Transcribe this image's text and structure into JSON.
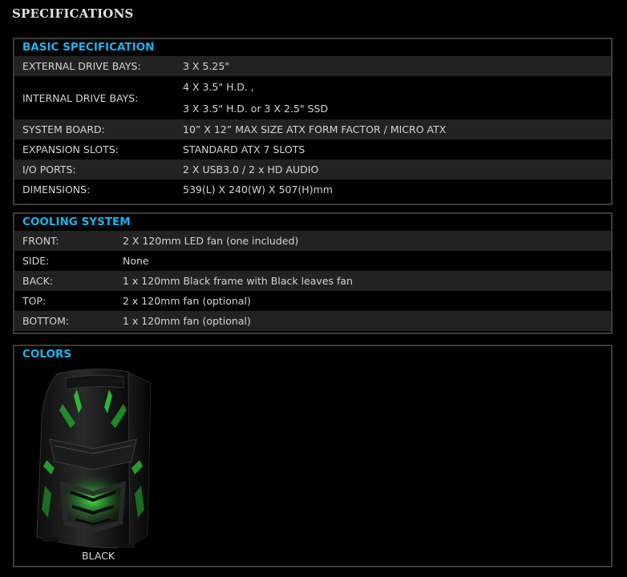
{
  "page": {
    "title": "SPECIFICATIONS"
  },
  "basic": {
    "heading": "BASIC SPECIFICATION",
    "rows": [
      {
        "key": "EXTERNAL DRIVE BAYS:",
        "value": "3 X 5.25\""
      },
      {
        "key": "INTERNAL DRIVE BAYS:",
        "values": [
          "4 X 3.5\" H.D. ,",
          "3 X 3.5\" H.D. or 3 X 2.5\" SSD"
        ]
      },
      {
        "key": "SYSTEM BOARD:",
        "value": "10” X 12” MAX SIZE ATX FORM FACTOR / MICRO ATX"
      },
      {
        "key": "EXPANSION SLOTS:",
        "value": "STANDARD ATX 7 SLOTS"
      },
      {
        "key": "I/O PORTS:",
        "value": "2 X USB3.0 / 2 x HD AUDIO"
      },
      {
        "key": "DIMENSIONS:",
        "value": "539(L) X 240(W) X 507(H)mm"
      }
    ]
  },
  "cooling": {
    "heading": "COOLING SYSTEM",
    "rows": [
      {
        "key": "FRONT:",
        "value": "2 X 120mm LED fan (one included)"
      },
      {
        "key": "SIDE:",
        "value": "None"
      },
      {
        "key": "BACK:",
        "value": "1 x 120mm Black frame with Black leaves fan"
      },
      {
        "key": "TOP:",
        "value": "2 x 120mm fan (optional)"
      },
      {
        "key": "BOTTOM:",
        "value": "1 x 120mm fan (optional)"
      }
    ]
  },
  "colors": {
    "heading": "COLORS",
    "items": [
      {
        "label": "BLACK"
      }
    ]
  },
  "theme": {
    "accent": "#19b4f0",
    "row_alt": "#222222",
    "border": "#3c3c3c",
    "glow": "#2fd13a"
  }
}
